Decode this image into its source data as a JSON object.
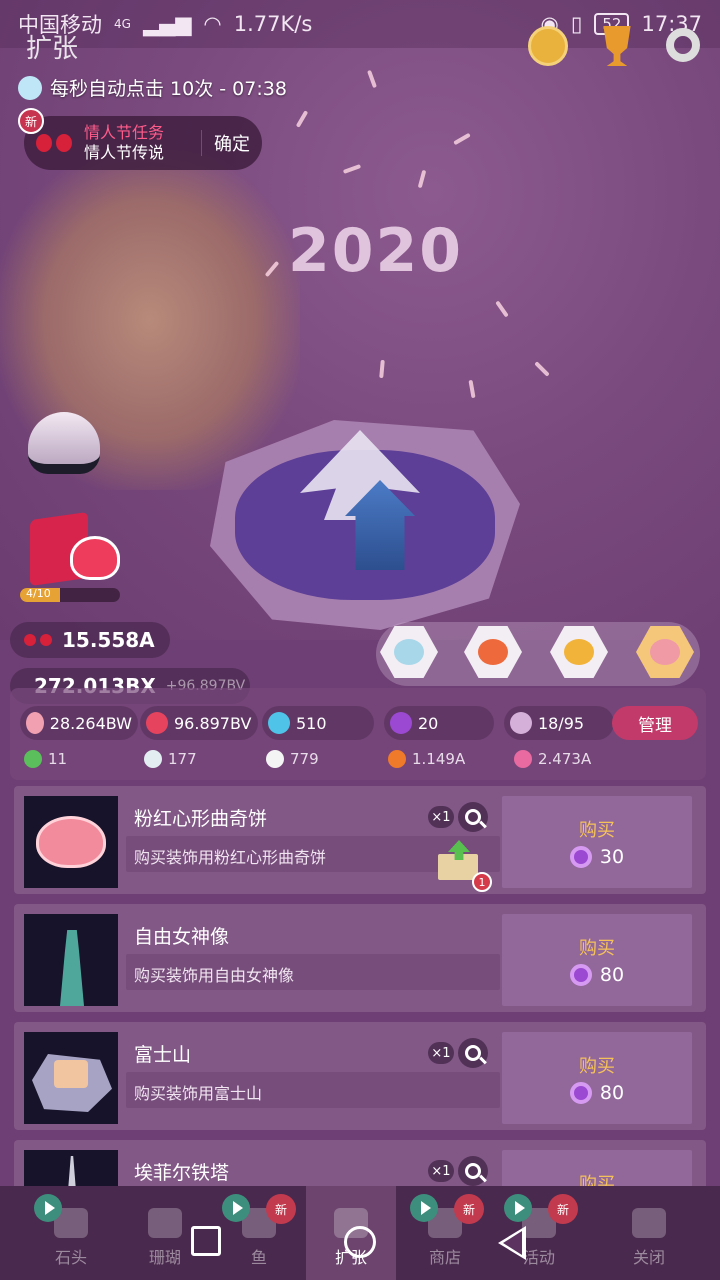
{
  "statusbar": {
    "carrier": "中国移动",
    "network": "4G",
    "speed": "1.77K/s",
    "battery": "52",
    "time": "17:37"
  },
  "header": {
    "title": "扩张",
    "autoclick": "每秒自动点击 10次 - 07:38"
  },
  "quest": {
    "badge": "新",
    "line1": "情人节任务",
    "line2": "情人节传说",
    "confirm": "确定"
  },
  "scene": {
    "year_text": "2020",
    "gift_progress_label": "4/10",
    "gift_progress": 0.4
  },
  "currency": {
    "bow_value": "15.558A",
    "heart_value": "272.013BX",
    "heart_rate": "+96.897BV"
  },
  "stats": {
    "tap": "28.264BW",
    "per_sec": "96.897BV",
    "diamond": "510",
    "gem": "20",
    "fish": "18/95",
    "manage": "管理"
  },
  "small_stats": {
    "leaf": "11",
    "rock": "177",
    "urchin": "779",
    "crab": "1.149A",
    "seahorse": "2.473A"
  },
  "items": [
    {
      "title": "粉红心形曲奇饼",
      "desc": "购买装饰用粉红心形曲奇饼",
      "qty": "×1",
      "buy": "购买",
      "price": "30",
      "upgrade_count": "1"
    },
    {
      "title": "自由女神像",
      "desc": "购买装饰用自由女神像",
      "qty": "",
      "buy": "购买",
      "price": "80"
    },
    {
      "title": "富士山",
      "desc": "购买装饰用富士山",
      "qty": "×1",
      "buy": "购买",
      "price": "80"
    },
    {
      "title": "埃菲尔铁塔",
      "desc": "",
      "qty": "×1",
      "buy": "购买",
      "price": ""
    }
  ],
  "tabs": [
    {
      "label": "石头"
    },
    {
      "label": "珊瑚"
    },
    {
      "label": "鱼"
    },
    {
      "label": "扩张"
    },
    {
      "label": "商店"
    },
    {
      "label": "活动"
    },
    {
      "label": "关闭"
    }
  ],
  "tab_badge": "新",
  "colors": {
    "background": "#6e3f74",
    "accent_pink": "#c23a6a",
    "buy_gold": "#f5c25a",
    "gem_purple": "#9b49d3"
  }
}
